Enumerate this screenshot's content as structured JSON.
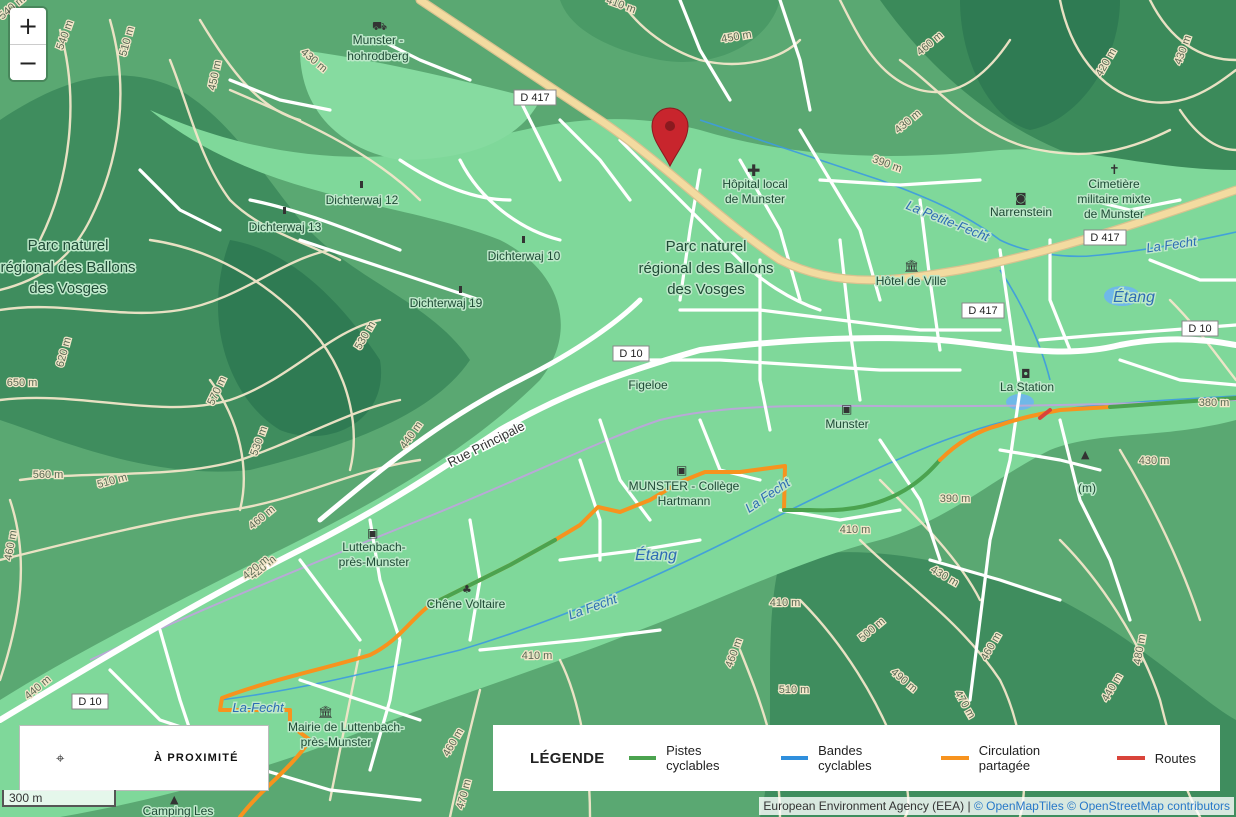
{
  "zoom": {
    "in_label": "+",
    "out_label": "−"
  },
  "map": {
    "places": {
      "parc_left": [
        "Parc naturel",
        "régional des Ballons",
        "des Vosges"
      ],
      "parc_center": [
        "Parc naturel",
        "régional des Ballons",
        "des Vosges"
      ],
      "munster_hohrodberg": [
        "Munster -",
        "hohrodberg"
      ],
      "dichterwaj_12": "Dichterwaj 12",
      "dichterwaj_13": "Dichterwaj 13",
      "dichterwaj_10": "Dichterwaj 10",
      "dichterwaj_19": "Dichterwaj 19",
      "hopital": [
        "Hôpital local",
        "de Munster"
      ],
      "hotel_de_ville": "Hôtel de Ville",
      "narrenstein": "Narrenstein",
      "cimetiere": [
        "Cimetière",
        "militaire mixte",
        "de Munster"
      ],
      "figeloe": "Figeloe",
      "munster_station": "Munster",
      "la_station": "La Station",
      "college": [
        "MUNSTER - Collège",
        "Hartmann"
      ],
      "luttenbach": [
        "Luttenbach-",
        "près-Munster"
      ],
      "chene_voltaire": "Chêne Voltaire",
      "mairie": [
        "Mairie de Luttenbach-",
        "près-Munster"
      ],
      "camping": "Camping Les",
      "m_label": "(m)"
    },
    "roads": {
      "d417_a": "D 417",
      "d417_b": "D 417",
      "d417_c": "D 417",
      "d10_a": "D 10",
      "d10_b": "D 10",
      "d10_c": "D 10",
      "rue_principale": "Rue Principale"
    },
    "water": {
      "la_petite_fecht": "La Petite-Fecht",
      "la_fecht_1": "La Fecht",
      "la_fecht_2": "La Fecht",
      "la_fecht_3": "La Fecht",
      "la_fecht_4": "La-Fecht",
      "etang_1": "Étang",
      "etang_2": "Étang"
    },
    "contours": {
      "c1": "540 m",
      "c2": "510 m",
      "c3": "450 m",
      "c4": "410 m",
      "c5": "450 m",
      "c6": "430 m",
      "c7": "460 m",
      "c8": "430 m",
      "c9": "390 m",
      "c10": "430 m",
      "c11": "420 m",
      "c12": "540 m",
      "c13": "650 m",
      "c14": "620 m",
      "c15": "530 m",
      "c16": "570 m",
      "c17": "560 m",
      "c18": "510 m",
      "c19": "530 m",
      "c20": "440 m",
      "c21": "460 m",
      "c22": "420 m",
      "c23": "440 m",
      "c24": "410 m",
      "c25": "410 m",
      "c26": "390 m",
      "c27": "430 m",
      "c28": "430 m",
      "c29": "410 m",
      "c30": "460 m",
      "c31": "500 m",
      "c32": "510 m",
      "c33": "490 m",
      "c34": "470 m",
      "c35": "460 m",
      "c36": "480 m",
      "c37": "440 m",
      "c38": "470 m",
      "c39": "460 m",
      "c40": "380 m",
      "c41": "420 m",
      "c42": "460 m"
    }
  },
  "nearby": {
    "icon": "crosshair-icon",
    "label": "À PROXIMITÉ"
  },
  "legend": {
    "title": "LÉGENDE",
    "items": [
      {
        "label": "Pistes cyclables",
        "color": "#4ba34f"
      },
      {
        "label": "Bandes cyclables",
        "color": "#2f8fdd"
      },
      {
        "label": "Circulation partagée",
        "color": "#f7931e"
      },
      {
        "label": "Routes",
        "color": "#d9443a"
      }
    ]
  },
  "scale": {
    "label": "300 m"
  },
  "attribution": {
    "text": "European Environment Agency (EEA) |",
    "link1": "© OpenMapTiles",
    "link2": "© OpenStreetMap contributors"
  },
  "colors": {
    "valley": "#7fd89a",
    "hill": "#5aa872",
    "dark_hill": "#2f7b53",
    "marker": "#c8252d"
  }
}
